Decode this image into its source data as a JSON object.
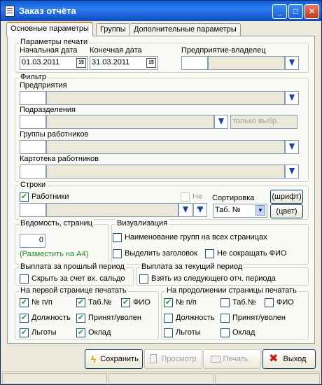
{
  "window": {
    "title": "Заказ отчёта"
  },
  "tabs": [
    "Основные параметры",
    "Группы",
    "Дополнительные параметры"
  ],
  "print_params": {
    "legend": "Параметры печати",
    "start_label": "Начальная дата",
    "end_label": "Конечная дата",
    "owner_label": "Предприятие-владелец",
    "start_value": "01.03.2011",
    "end_value": "31.03.2011",
    "cal_icon": "15"
  },
  "filter": {
    "legend": "Фильтр",
    "enterprises": "Предприятия",
    "divisions": "Подразделения",
    "only_selected": "только выбр.",
    "worker_groups": "Группы работников",
    "worker_cards": "Картотека работников"
  },
  "rows": {
    "legend": "Строки",
    "workers": "Работники",
    "not_label": "Не",
    "sort_label": "Сортировка",
    "sort_value": "Таб. №",
    "font_button": "(шрифт)",
    "color_button": "(цвет)",
    "dots": "···"
  },
  "pages": {
    "legend": "Ведомость, страниц",
    "value": "0",
    "note": "(Разместить на А4)"
  },
  "visual": {
    "legend": "Визуализация",
    "group_names": "Наименование групп на всех страницах",
    "highlight_header": "Выделить заголовок",
    "no_shorten": "Не сокращать ФИО"
  },
  "past_pay": {
    "legend": "Выплата за прошлый период",
    "hide": "Скрыть за счет вх. сальдо"
  },
  "current_pay": {
    "legend": "Выплата за текущий период",
    "next": "Взять из следующего отч. периода"
  },
  "first_page": {
    "legend": "На первой странице печатать",
    "items": [
      "№ п/п",
      "Таб.№",
      "ФИО",
      "Должность",
      "Принят/уволен",
      "Льготы",
      "Оклад"
    ]
  },
  "continued": {
    "legend": "На продолжении страницы печатать",
    "items": [
      "№ п/п",
      "Таб.№",
      "ФИО",
      "Должность",
      "Принят/уволен",
      "Льготы",
      "Оклад"
    ]
  },
  "footer": {
    "save": "Сохранить",
    "preview": "Просмотр",
    "print": "Печать",
    "exit": "Выход"
  },
  "checks": {
    "mark": "✔"
  }
}
